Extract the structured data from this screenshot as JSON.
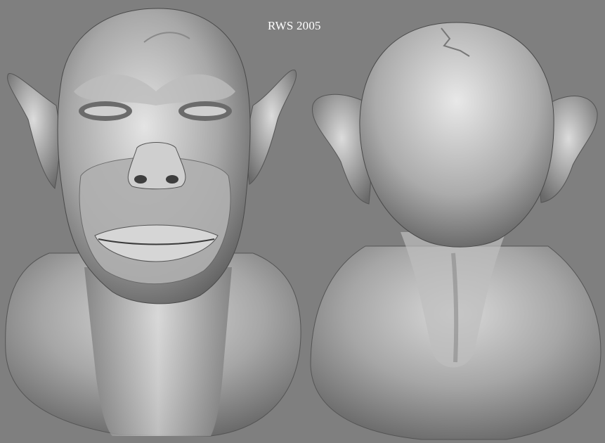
{
  "caption": {
    "text": "RWS 2005",
    "color": "#ffffff"
  },
  "colors": {
    "background": "#7f7f7f",
    "clay_light": "#e2e2e2",
    "clay_mid": "#9a9a9a",
    "clay_dark": "#4a4a4a"
  },
  "views": [
    {
      "name": "front-view"
    },
    {
      "name": "back-view"
    }
  ]
}
